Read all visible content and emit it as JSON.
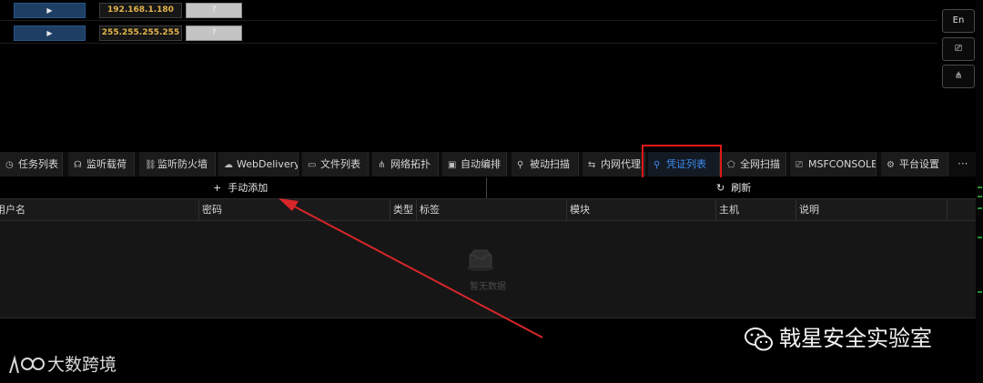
{
  "ip_rows": [
    {
      "play": "▶",
      "ip": "192.168.1.180",
      "q": "?"
    },
    {
      "play": "▶",
      "ip": "255.255.255.255",
      "q": "?"
    }
  ],
  "right_buttons": {
    "lang": "En",
    "terminal": "⎚",
    "topology": "⋔"
  },
  "tabs": [
    {
      "label": "任务列表",
      "icon": "◷"
    },
    {
      "label": "监听载荷",
      "icon": "☊"
    },
    {
      "label": "监听防火墙",
      "icon": "⛓"
    },
    {
      "label": "WebDelivery",
      "icon": "☁"
    },
    {
      "label": "文件列表",
      "icon": "▭"
    },
    {
      "label": "网络拓扑",
      "icon": "⋔"
    },
    {
      "label": "自动编排",
      "icon": "▣"
    },
    {
      "label": "被动扫描",
      "icon": "⚲"
    },
    {
      "label": "内网代理",
      "icon": "⇆"
    },
    {
      "label": "凭证列表",
      "icon": "⚲"
    },
    {
      "label": "全网扫描",
      "icon": "⬠"
    },
    {
      "label": "MSFCONSOLE",
      "icon": "⎚"
    },
    {
      "label": "平台设置",
      "icon": "⚙"
    }
  ],
  "more": "···",
  "toolbar": {
    "add_icon": "+",
    "add_label": "手动添加",
    "refresh_icon": "↻",
    "refresh_label": "刷新"
  },
  "table": {
    "headers": [
      "用户名",
      "密码",
      "类型",
      "标签",
      "模块",
      "主机",
      "说明"
    ],
    "empty_text": "暂无数据"
  },
  "watermark": {
    "text": "戟星安全实验室"
  },
  "brand": {
    "text": "大数跨境"
  },
  "colors": {
    "active_tab": "#3d8cf0",
    "highlight": "#e01818",
    "ip_text": "#e3b44b"
  }
}
